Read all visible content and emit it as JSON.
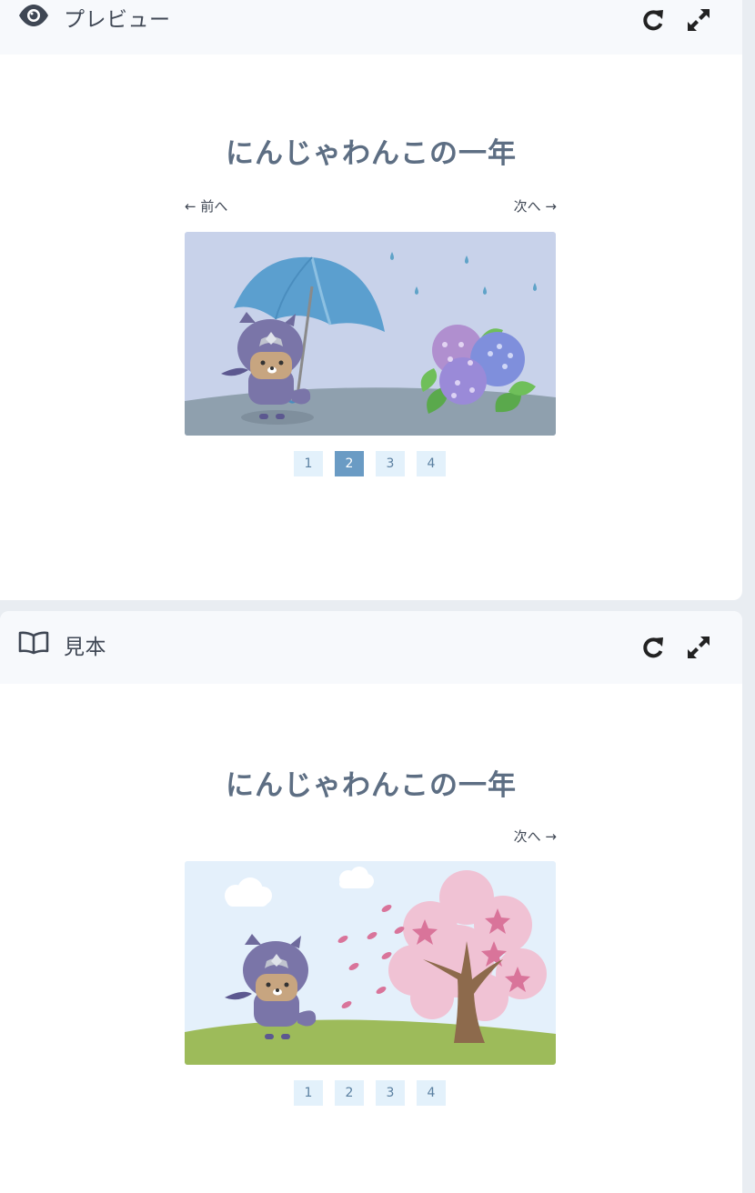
{
  "preview": {
    "header_title": "プレビュー",
    "header_icon": "eye-icon",
    "book_title": "にんじゃわんこの一年",
    "prev_label": "← 前へ",
    "next_label": "次へ →",
    "scene": "rainy-hydrangea",
    "pages": [
      "1",
      "2",
      "3",
      "4"
    ],
    "active_page": "2"
  },
  "sample": {
    "header_title": "見本",
    "header_icon": "book-icon",
    "book_title": "にんじゃわんこの一年",
    "next_label": "次へ →",
    "scene": "cherry-blossom",
    "pages": [
      "1",
      "2",
      "3",
      "4"
    ],
    "active_page": ""
  },
  "colors": {
    "page_bg": "#e9edf2",
    "header_bg": "#f7f9fc",
    "title": "#5d6e83",
    "page_btn_bg": "#e3f1fb",
    "page_btn_active": "#6a9bc4"
  }
}
